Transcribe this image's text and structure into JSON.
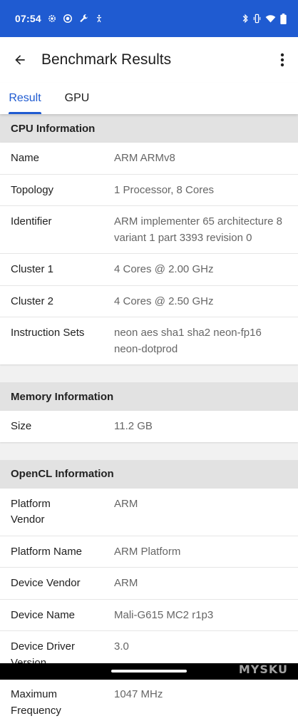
{
  "status_bar": {
    "time": "07:54",
    "bg_color": "#1f5bd1"
  },
  "app_bar": {
    "title": "Benchmark Results"
  },
  "tabs": [
    {
      "label": "Result",
      "selected": true
    },
    {
      "label": "GPU",
      "selected": false
    }
  ],
  "accent_color": "#1f5bd1",
  "sections": {
    "cpu": {
      "title": "CPU Information",
      "rows": [
        {
          "label": "Name",
          "value": "ARM ARMv8"
        },
        {
          "label": "Topology",
          "value": "1 Processor, 8 Cores"
        },
        {
          "label": "Identifier",
          "value": "ARM implementer 65 architecture 8 variant 1 part 3393 revision 0"
        },
        {
          "label": "Cluster 1",
          "value": "4 Cores @ 2.00 GHz"
        },
        {
          "label": "Cluster 2",
          "value": "4 Cores @ 2.50 GHz"
        },
        {
          "label": "Instruction Sets",
          "value": "neon aes sha1 sha2 neon-fp16 neon-dotprod"
        }
      ]
    },
    "memory": {
      "title": "Memory Information",
      "rows": [
        {
          "label": "Size",
          "value": "11.2 GB"
        }
      ]
    },
    "opencl": {
      "title": "OpenCL Information",
      "rows": [
        {
          "label": "Platform Vendor",
          "value": "ARM"
        },
        {
          "label": "Platform Name",
          "value": "ARM Platform"
        },
        {
          "label": "Device Vendor",
          "value": "ARM"
        },
        {
          "label": "Device Name",
          "value": "Mali-G615 MC2 r1p3"
        },
        {
          "label": "Device Driver Version",
          "value": "3.0"
        },
        {
          "label": "Maximum Frequency",
          "value": "1047 MHz"
        }
      ]
    }
  },
  "watermark": "MYSKU"
}
